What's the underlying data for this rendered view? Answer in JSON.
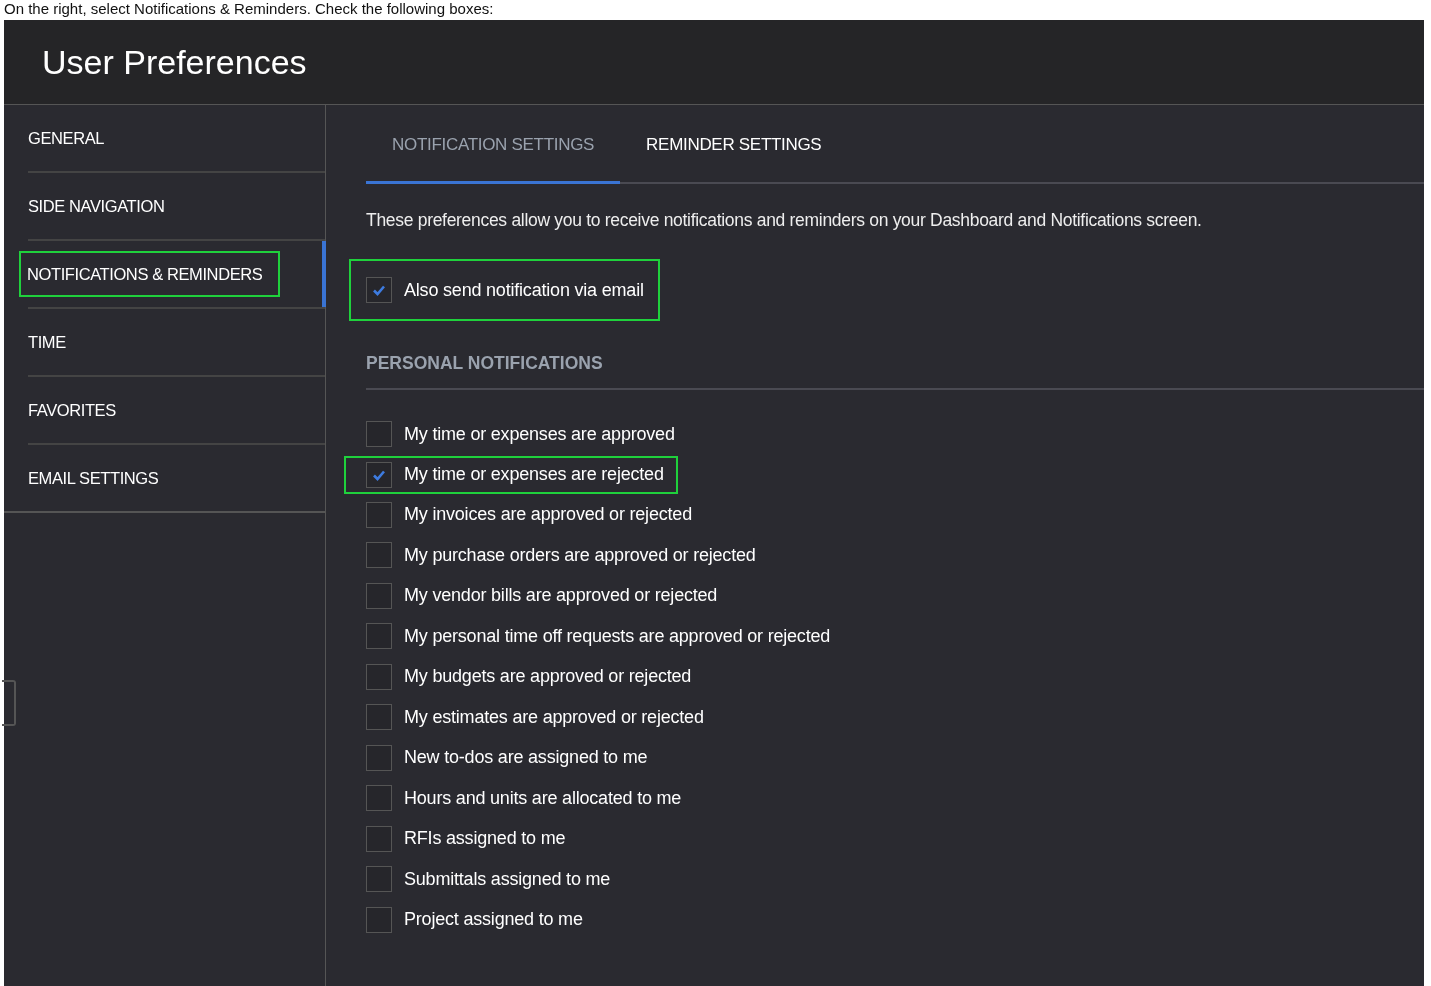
{
  "caption": "On the right, select Notifications & Reminders. Check the following boxes:",
  "window": {
    "title": "User Preferences"
  },
  "sidebar": {
    "items": [
      {
        "label": "GENERAL",
        "selected": false,
        "highlighted": false
      },
      {
        "label": "SIDE NAVIGATION",
        "selected": false,
        "highlighted": false
      },
      {
        "label": "NOTIFICATIONS & REMINDERS",
        "selected": true,
        "highlighted": true
      },
      {
        "label": "TIME",
        "selected": false,
        "highlighted": false
      },
      {
        "label": "FAVORITES",
        "selected": false,
        "highlighted": false
      },
      {
        "label": "EMAIL SETTINGS",
        "selected": false,
        "highlighted": false
      }
    ]
  },
  "tabs": [
    {
      "label": "NOTIFICATION SETTINGS",
      "selected": true
    },
    {
      "label": "REMINDER SETTINGS",
      "selected": false
    }
  ],
  "intro": "These preferences allow you to receive notifications and reminders on your Dashboard and Notifications screen.",
  "email_option": {
    "label": "Also send notification via email",
    "checked": true,
    "highlighted": true
  },
  "section": {
    "title": "PERSONAL NOTIFICATIONS",
    "options": [
      {
        "label": "My time or expenses are approved",
        "checked": false,
        "highlighted": false
      },
      {
        "label": "My time or expenses are rejected",
        "checked": true,
        "highlighted": true
      },
      {
        "label": "My invoices are approved or rejected",
        "checked": false,
        "highlighted": false
      },
      {
        "label": "My purchase orders are approved or rejected",
        "checked": false,
        "highlighted": false
      },
      {
        "label": "My vendor bills are approved or rejected",
        "checked": false,
        "highlighted": false
      },
      {
        "label": "My personal time off requests are approved or rejected",
        "checked": false,
        "highlighted": false
      },
      {
        "label": "My budgets are approved or rejected",
        "checked": false,
        "highlighted": false
      },
      {
        "label": "My estimates are approved or rejected",
        "checked": false,
        "highlighted": false
      },
      {
        "label": "New to-dos are assigned to me",
        "checked": false,
        "highlighted": false
      },
      {
        "label": "Hours and units are allocated to me",
        "checked": false,
        "highlighted": false
      },
      {
        "label": "RFIs assigned to me",
        "checked": false,
        "highlighted": false
      },
      {
        "label": "Submittals assigned to me",
        "checked": false,
        "highlighted": false
      },
      {
        "label": "Project assigned to me",
        "checked": false,
        "highlighted": false
      }
    ]
  }
}
